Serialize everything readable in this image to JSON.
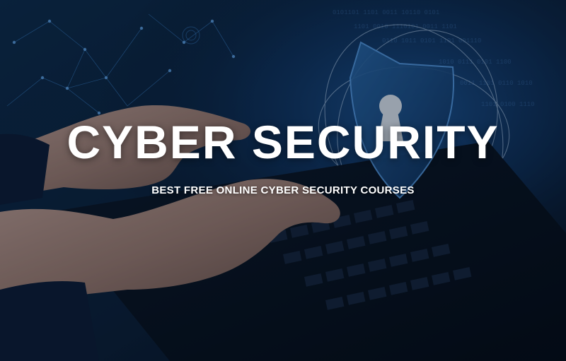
{
  "hero": {
    "title": "CYBER SECURITY",
    "subtitle": "BEST FREE ONLINE CYBER SECURITY COURSES"
  },
  "palette": {
    "background": "#071526",
    "accent": "#2a7fd0",
    "text": "#ffffff"
  },
  "icons": [
    "shield-keyhole-icon",
    "network-lines",
    "binary-code-pattern"
  ]
}
